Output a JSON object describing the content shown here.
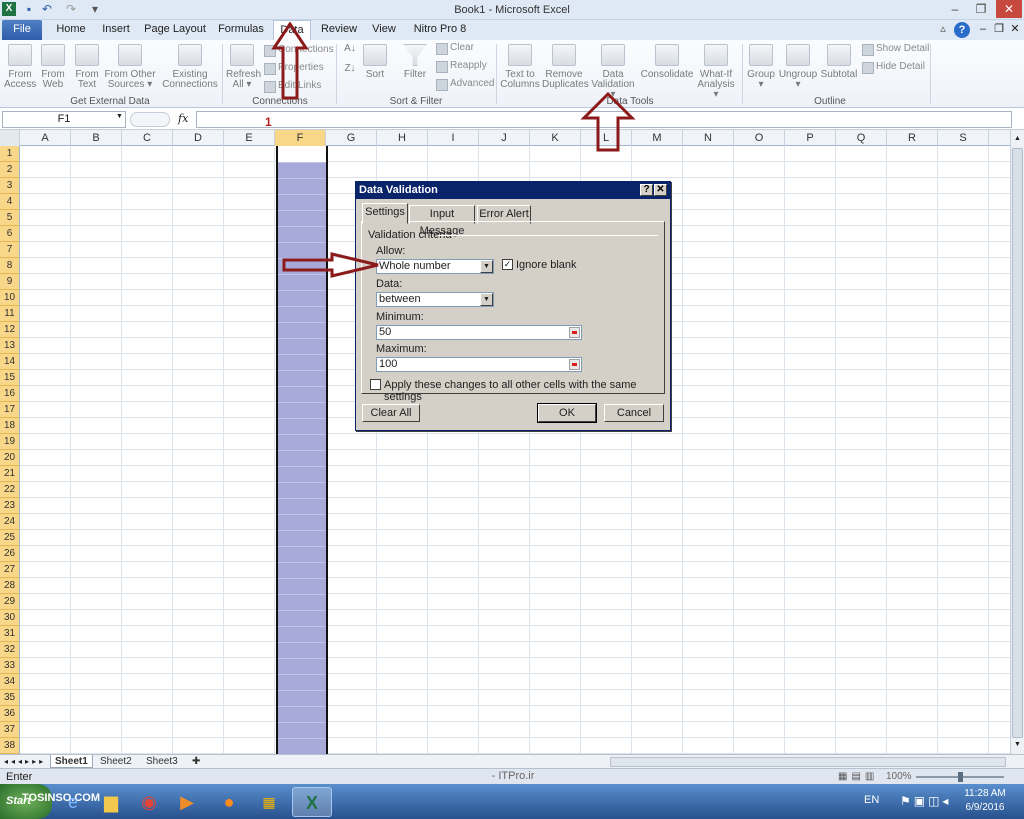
{
  "window": {
    "title": "Book1 - Microsoft Excel"
  },
  "tabs": [
    "File",
    "Home",
    "Insert",
    "Page Layout",
    "Formulas",
    "Data",
    "Review",
    "View",
    "Nitro Pro 8"
  ],
  "ribbon": {
    "get_external": [
      {
        "label": "From",
        "sub": "Access"
      },
      {
        "label": "From",
        "sub": "Web"
      },
      {
        "label": "From",
        "sub": "Text"
      },
      {
        "label": "From Other",
        "sub": "Sources ▾"
      },
      {
        "label": "Existing",
        "sub": "Connections"
      }
    ],
    "connections": {
      "refresh": "Refresh",
      "refresh_sub": "All ▾",
      "items": [
        "Connections",
        "Properties",
        "Edit Links"
      ]
    },
    "sort": {
      "sort": "Sort",
      "filter": "Filter",
      "clear": "Clear",
      "reapply": "Reapply",
      "advanced": "Advanced"
    },
    "tools": [
      {
        "label": "Text to",
        "sub": "Columns"
      },
      {
        "label": "Remove",
        "sub": "Duplicates"
      },
      {
        "label": "Data",
        "sub": "Validation ▾"
      },
      {
        "label": "Consolidate",
        "sub": ""
      },
      {
        "label": "What-If",
        "sub": "Analysis ▾"
      }
    ],
    "outline": [
      {
        "label": "Group",
        "sub": "▾"
      },
      {
        "label": "Ungroup",
        "sub": "▾"
      },
      {
        "label": "Subtotal",
        "sub": ""
      }
    ],
    "outline_small": [
      "Show Detail",
      "Hide Detail"
    ],
    "groups": [
      "Get External Data",
      "Connections",
      "Sort & Filter",
      "Data Tools",
      "Outline"
    ]
  },
  "formula_bar": {
    "name_box": "F1",
    "fx": "fx",
    "formula": ""
  },
  "columns": [
    "A",
    "B",
    "C",
    "D",
    "E",
    "F",
    "G",
    "H",
    "I",
    "J",
    "K",
    "L",
    "M",
    "N",
    "O",
    "P",
    "Q",
    "R",
    "S"
  ],
  "rows": [
    "1",
    "2",
    "3",
    "4",
    "5",
    "6",
    "7",
    "8",
    "9",
    "10",
    "11",
    "12",
    "13",
    "14",
    "15",
    "16",
    "17",
    "18",
    "19",
    "20",
    "21",
    "22",
    "23",
    "24",
    "25",
    "26",
    "27",
    "28",
    "29",
    "30",
    "31",
    "32",
    "33",
    "34",
    "35",
    "36",
    "37",
    "38"
  ],
  "annotation_number": "1",
  "dialog": {
    "title": "Data Validation",
    "tabs": [
      "Settings",
      "Input Message",
      "Error Alert"
    ],
    "section": "Validation criteria",
    "allow_label": "Allow:",
    "allow_value": "Whole number",
    "ignore_blank": "Ignore blank",
    "data_label": "Data:",
    "data_value": "between",
    "min_label": "Minimum:",
    "min_value": "50",
    "max_label": "Maximum:",
    "max_value": "100",
    "apply_all": "Apply these changes to all other cells with the same settings",
    "clear_all": "Clear All",
    "ok": "OK",
    "cancel": "Cancel"
  },
  "sheets": [
    "Sheet1",
    "Sheet2",
    "Sheet3"
  ],
  "status": {
    "mode": "Enter",
    "zoom": "100%"
  },
  "watermark": {
    "latin": "TOSINSO.COM",
    "itpro": "ITPro.ir"
  },
  "taskbar": {
    "start": "Start",
    "lang": "EN",
    "time": "11:28 AM",
    "date": "6/9/2016"
  },
  "colors": {
    "accent": "#2b579a",
    "selection": "#a7a9d9",
    "arrow": "#8b1a1a"
  }
}
